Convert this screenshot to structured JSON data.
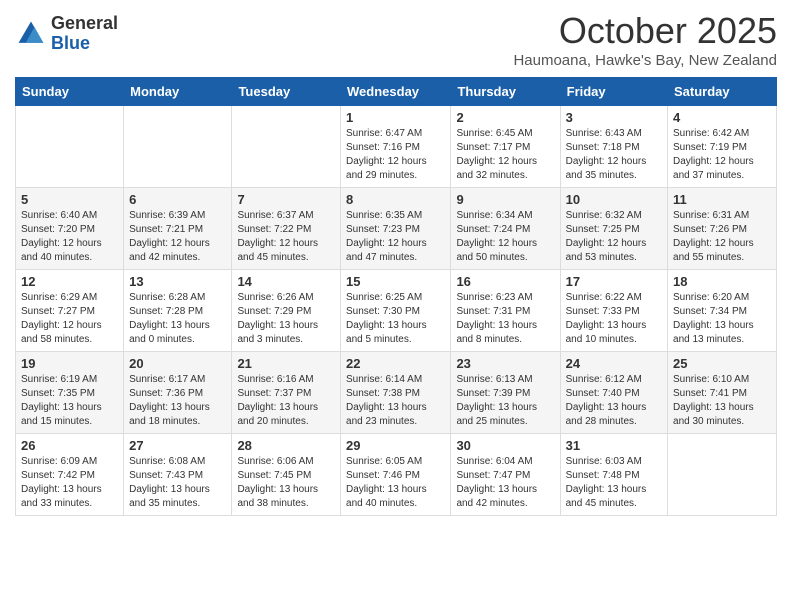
{
  "logo": {
    "general": "General",
    "blue": "Blue"
  },
  "header": {
    "month": "October 2025",
    "location": "Haumoana, Hawke's Bay, New Zealand"
  },
  "weekdays": [
    "Sunday",
    "Monday",
    "Tuesday",
    "Wednesday",
    "Thursday",
    "Friday",
    "Saturday"
  ],
  "weeks": [
    [
      {
        "day": "",
        "info": ""
      },
      {
        "day": "",
        "info": ""
      },
      {
        "day": "",
        "info": ""
      },
      {
        "day": "1",
        "info": "Sunrise: 6:47 AM\nSunset: 7:16 PM\nDaylight: 12 hours and 29 minutes."
      },
      {
        "day": "2",
        "info": "Sunrise: 6:45 AM\nSunset: 7:17 PM\nDaylight: 12 hours and 32 minutes."
      },
      {
        "day": "3",
        "info": "Sunrise: 6:43 AM\nSunset: 7:18 PM\nDaylight: 12 hours and 35 minutes."
      },
      {
        "day": "4",
        "info": "Sunrise: 6:42 AM\nSunset: 7:19 PM\nDaylight: 12 hours and 37 minutes."
      }
    ],
    [
      {
        "day": "5",
        "info": "Sunrise: 6:40 AM\nSunset: 7:20 PM\nDaylight: 12 hours and 40 minutes."
      },
      {
        "day": "6",
        "info": "Sunrise: 6:39 AM\nSunset: 7:21 PM\nDaylight: 12 hours and 42 minutes."
      },
      {
        "day": "7",
        "info": "Sunrise: 6:37 AM\nSunset: 7:22 PM\nDaylight: 12 hours and 45 minutes."
      },
      {
        "day": "8",
        "info": "Sunrise: 6:35 AM\nSunset: 7:23 PM\nDaylight: 12 hours and 47 minutes."
      },
      {
        "day": "9",
        "info": "Sunrise: 6:34 AM\nSunset: 7:24 PM\nDaylight: 12 hours and 50 minutes."
      },
      {
        "day": "10",
        "info": "Sunrise: 6:32 AM\nSunset: 7:25 PM\nDaylight: 12 hours and 53 minutes."
      },
      {
        "day": "11",
        "info": "Sunrise: 6:31 AM\nSunset: 7:26 PM\nDaylight: 12 hours and 55 minutes."
      }
    ],
    [
      {
        "day": "12",
        "info": "Sunrise: 6:29 AM\nSunset: 7:27 PM\nDaylight: 12 hours and 58 minutes."
      },
      {
        "day": "13",
        "info": "Sunrise: 6:28 AM\nSunset: 7:28 PM\nDaylight: 13 hours and 0 minutes."
      },
      {
        "day": "14",
        "info": "Sunrise: 6:26 AM\nSunset: 7:29 PM\nDaylight: 13 hours and 3 minutes."
      },
      {
        "day": "15",
        "info": "Sunrise: 6:25 AM\nSunset: 7:30 PM\nDaylight: 13 hours and 5 minutes."
      },
      {
        "day": "16",
        "info": "Sunrise: 6:23 AM\nSunset: 7:31 PM\nDaylight: 13 hours and 8 minutes."
      },
      {
        "day": "17",
        "info": "Sunrise: 6:22 AM\nSunset: 7:33 PM\nDaylight: 13 hours and 10 minutes."
      },
      {
        "day": "18",
        "info": "Sunrise: 6:20 AM\nSunset: 7:34 PM\nDaylight: 13 hours and 13 minutes."
      }
    ],
    [
      {
        "day": "19",
        "info": "Sunrise: 6:19 AM\nSunset: 7:35 PM\nDaylight: 13 hours and 15 minutes."
      },
      {
        "day": "20",
        "info": "Sunrise: 6:17 AM\nSunset: 7:36 PM\nDaylight: 13 hours and 18 minutes."
      },
      {
        "day": "21",
        "info": "Sunrise: 6:16 AM\nSunset: 7:37 PM\nDaylight: 13 hours and 20 minutes."
      },
      {
        "day": "22",
        "info": "Sunrise: 6:14 AM\nSunset: 7:38 PM\nDaylight: 13 hours and 23 minutes."
      },
      {
        "day": "23",
        "info": "Sunrise: 6:13 AM\nSunset: 7:39 PM\nDaylight: 13 hours and 25 minutes."
      },
      {
        "day": "24",
        "info": "Sunrise: 6:12 AM\nSunset: 7:40 PM\nDaylight: 13 hours and 28 minutes."
      },
      {
        "day": "25",
        "info": "Sunrise: 6:10 AM\nSunset: 7:41 PM\nDaylight: 13 hours and 30 minutes."
      }
    ],
    [
      {
        "day": "26",
        "info": "Sunrise: 6:09 AM\nSunset: 7:42 PM\nDaylight: 13 hours and 33 minutes."
      },
      {
        "day": "27",
        "info": "Sunrise: 6:08 AM\nSunset: 7:43 PM\nDaylight: 13 hours and 35 minutes."
      },
      {
        "day": "28",
        "info": "Sunrise: 6:06 AM\nSunset: 7:45 PM\nDaylight: 13 hours and 38 minutes."
      },
      {
        "day": "29",
        "info": "Sunrise: 6:05 AM\nSunset: 7:46 PM\nDaylight: 13 hours and 40 minutes."
      },
      {
        "day": "30",
        "info": "Sunrise: 6:04 AM\nSunset: 7:47 PM\nDaylight: 13 hours and 42 minutes."
      },
      {
        "day": "31",
        "info": "Sunrise: 6:03 AM\nSunset: 7:48 PM\nDaylight: 13 hours and 45 minutes."
      },
      {
        "day": "",
        "info": ""
      }
    ]
  ]
}
